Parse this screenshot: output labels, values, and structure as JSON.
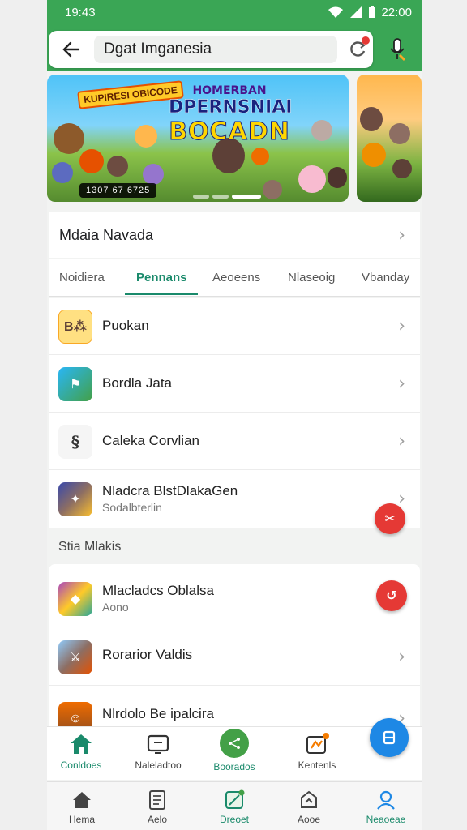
{
  "status": {
    "time": "19:43",
    "right_time": "22:00"
  },
  "search": {
    "value": "Dgat Imganesia"
  },
  "banner": {
    "tag": "KUPIRESI OBICODE",
    "title_line1": "HOMERBAN",
    "title_line2": "DPERNSNIAI",
    "title_line3": "BOCADN",
    "code": "1307 67 6725"
  },
  "section": {
    "title": "Mdaia Navada"
  },
  "tabs": [
    "Noidiera",
    "Pennans",
    "Aeoeens",
    "Nlaseoig",
    "Vbanday"
  ],
  "tabs_active_index": 1,
  "list1": [
    {
      "title": "Puokan",
      "icon": "puzzle-game-icon"
    },
    {
      "title": "Bordla Jata",
      "icon": "board-game-icon"
    },
    {
      "title": "Caleka Corvlian",
      "icon": "scribble-logo-icon"
    },
    {
      "title": "Nladcra BlstDlakaGen",
      "subtitle": "Sodalbterlin",
      "icon": "adventure-game-icon"
    }
  ],
  "subsection": {
    "title": "Stia Mlakis"
  },
  "list2": [
    {
      "title": "Mlacladcs Oblalsa",
      "subtitle": "Aono",
      "icon": "gems-game-icon"
    },
    {
      "title": "Rorarior Valdis",
      "icon": "warrior-game-icon"
    },
    {
      "title": "Nlrdolo Be ipalcira",
      "icon": "cowboy-game-icon"
    }
  ],
  "quickbar": [
    {
      "label": "Conldoes",
      "icon": "home-icon"
    },
    {
      "label": "Naleladtoo",
      "icon": "tv-icon"
    },
    {
      "label": "Boorados",
      "icon": "share-icon"
    },
    {
      "label": "Kentenls",
      "icon": "badge-icon"
    }
  ],
  "bottom_nav": [
    {
      "label": "Hema",
      "icon": "home-icon"
    },
    {
      "label": "Aelo",
      "icon": "document-icon"
    },
    {
      "label": "Dreoet",
      "icon": "games-icon"
    },
    {
      "label": "Aooe",
      "icon": "apps-icon"
    },
    {
      "label": "Neaoeae",
      "icon": "profile-icon"
    }
  ],
  "colors": {
    "accent": "#3aa655",
    "active_tab": "#1a8a6b",
    "fab_red": "#e53935",
    "fab_blue": "#1e88e5"
  }
}
